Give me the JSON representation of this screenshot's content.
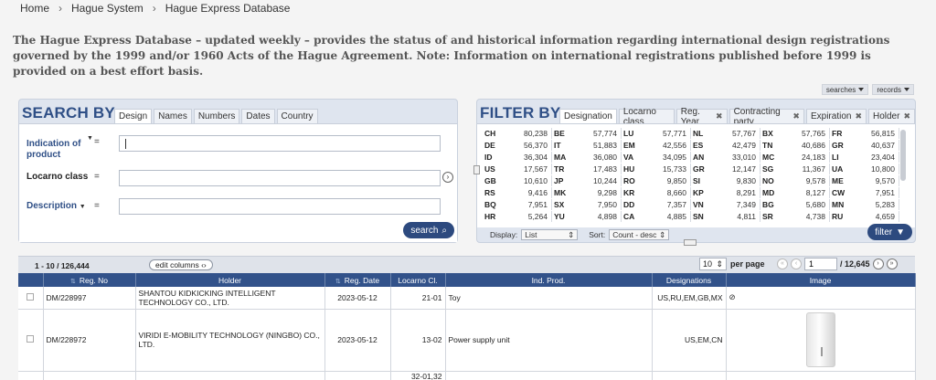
{
  "breadcrumb": [
    "Home",
    "Hague System",
    "Hague Express Database"
  ],
  "intro_text": "The Hague Express Database – updated weekly – provides the status of and historical information regarding international design registrations governed by the 1999 and/or 1960 Acts of the Hague Agreement. Note: Information on international registrations published before 1999 is provided on a best effort basis.",
  "toolbar": {
    "searches_label": "searches",
    "records_label": "records"
  },
  "search": {
    "title": "SEARCH BY",
    "tabs": [
      "Design",
      "Names",
      "Numbers",
      "Dates",
      "Country"
    ],
    "fields": [
      {
        "label": "Indication of product",
        "op": "=",
        "value": ""
      },
      {
        "label": "Locarno class",
        "op": "=",
        "value": ""
      },
      {
        "label": "Description",
        "op": "=",
        "value": ""
      }
    ],
    "search_button": "search"
  },
  "filter": {
    "title": "FILTER BY",
    "tabs": [
      "Designation",
      "Locarno class",
      "Reg. Year",
      "Contracting party",
      "Expiration",
      "Holder"
    ],
    "items": [
      [
        "CH",
        "80,238"
      ],
      [
        "BE",
        "57,774"
      ],
      [
        "LU",
        "57,771"
      ],
      [
        "NL",
        "57,767"
      ],
      [
        "BX",
        "57,765"
      ],
      [
        "FR",
        "56,815"
      ],
      [
        "DE",
        "56,370"
      ],
      [
        "IT",
        "51,883"
      ],
      [
        "EM",
        "42,556"
      ],
      [
        "ES",
        "42,479"
      ],
      [
        "TN",
        "40,686"
      ],
      [
        "GR",
        "40,637"
      ],
      [
        "ID",
        "36,304"
      ],
      [
        "MA",
        "36,080"
      ],
      [
        "VA",
        "34,095"
      ],
      [
        "AN",
        "33,010"
      ],
      [
        "MC",
        "24,183"
      ],
      [
        "LI",
        "23,404"
      ],
      [
        "US",
        "17,567"
      ],
      [
        "TR",
        "17,483"
      ],
      [
        "HU",
        "15,733"
      ],
      [
        "GR",
        "12,147"
      ],
      [
        "SG",
        "11,367"
      ],
      [
        "UA",
        "10,800"
      ],
      [
        "GB",
        "10,610"
      ],
      [
        "JP",
        "10,244"
      ],
      [
        "RO",
        "9,850"
      ],
      [
        "SI",
        "9,830"
      ],
      [
        "NO",
        "9,578"
      ],
      [
        "ME",
        "9,570"
      ],
      [
        "RS",
        "9,416"
      ],
      [
        "MK",
        "9,298"
      ],
      [
        "KR",
        "8,660"
      ],
      [
        "KP",
        "8,291"
      ],
      [
        "MD",
        "8,127"
      ],
      [
        "CW",
        "7,951"
      ],
      [
        "BQ",
        "7,951"
      ],
      [
        "SX",
        "7,950"
      ],
      [
        "DD",
        "7,357"
      ],
      [
        "VN",
        "7,349"
      ],
      [
        "BG",
        "5,680"
      ],
      [
        "MN",
        "5,283"
      ],
      [
        "HR",
        "5,264"
      ],
      [
        "YU",
        "4,898"
      ],
      [
        "CA",
        "4,885"
      ],
      [
        "SN",
        "4,811"
      ],
      [
        "SR",
        "4,738"
      ],
      [
        "RU",
        "4,659"
      ]
    ],
    "display_label": "Display:",
    "display_value": "List",
    "sort_label": "Sort:",
    "sort_value": "Count - desc",
    "filter_button": "filter"
  },
  "results": {
    "range": "1 - 10 / 126,444",
    "edit_columns": "edit columns",
    "per_page_value": "10",
    "per_page_label": "per page",
    "page_value": "1",
    "page_total": "/ 12,645",
    "columns": [
      "Reg. No",
      "Holder",
      "Reg. Date",
      "Locarno Cl.",
      "Ind. Prod.",
      "Designations",
      "Image"
    ],
    "rows": [
      {
        "reg_no": "DM/228997",
        "holder": "SHANTOU KIDKICKING INTELLIGENT TECHNOLOGY CO., LTD.",
        "reg_date": "2023-05-12",
        "locarno": "21-01",
        "ind_prod": "Toy",
        "designations": "US,RU,EM,GB,MX",
        "image": "⊘"
      },
      {
        "reg_no": "DM/228972",
        "holder": "VIRIDI E-MOBILITY TECHNOLOGY (NINGBO) CO., LTD.",
        "reg_date": "2023-05-12",
        "locarno": "13-02",
        "ind_prod": "Power supply unit",
        "designations": "US,EM,CN",
        "image": ""
      },
      {
        "reg_no": "",
        "holder": "",
        "reg_date": "",
        "locarno": "32-01,32",
        "ind_prod": "",
        "designations": "",
        "image": ""
      }
    ]
  }
}
